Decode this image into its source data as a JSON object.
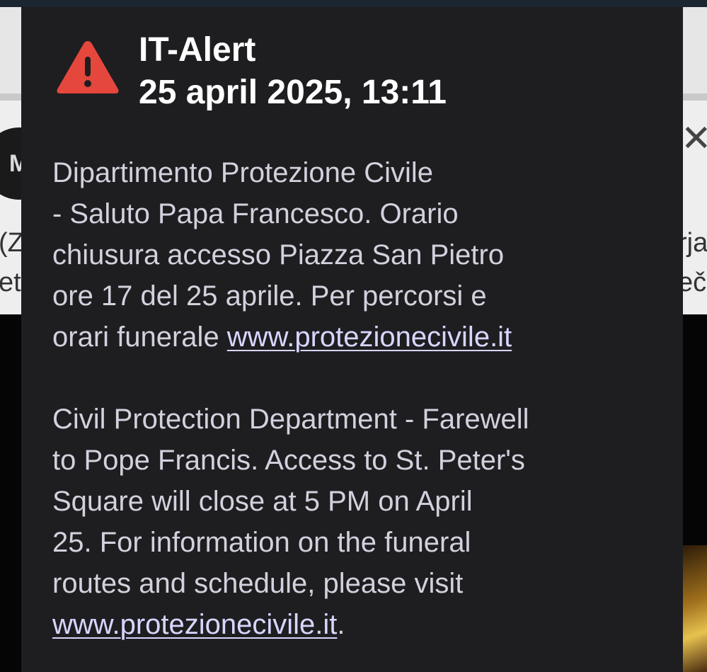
{
  "background": {
    "avatar_text": "M",
    "left_line_1": "(Z",
    "left_line_2": "et",
    "right_line_1": "rja",
    "right_line_2": "eč",
    "close_symbol": "✕"
  },
  "alert": {
    "icon": "warning-triangle-icon",
    "icon_color": "#e5473d",
    "title": "IT-Alert",
    "datetime": "25 april 2025, 13:11",
    "message_it": {
      "line_1": "Dipartimento Protezione Civile",
      "line_2": "- Saluto Papa Francesco. Orario",
      "line_3": "chiusura accesso Piazza San Pietro",
      "line_4": "ore 17 del 25 aprile. Per percorsi e",
      "line_5_prefix": "orari funerale ",
      "link": "www.protezionecivile.it"
    },
    "message_en": {
      "line_1": "Civil Protection Department - Farewell",
      "line_2": "to Pope Francis. Access to St. Peter's",
      "line_3": "Square will close at 5 PM on April",
      "line_4": "25. For information on the funeral",
      "line_5": "routes and schedule, please visit",
      "link": "www.protezionecivile.it",
      "suffix": "."
    }
  }
}
